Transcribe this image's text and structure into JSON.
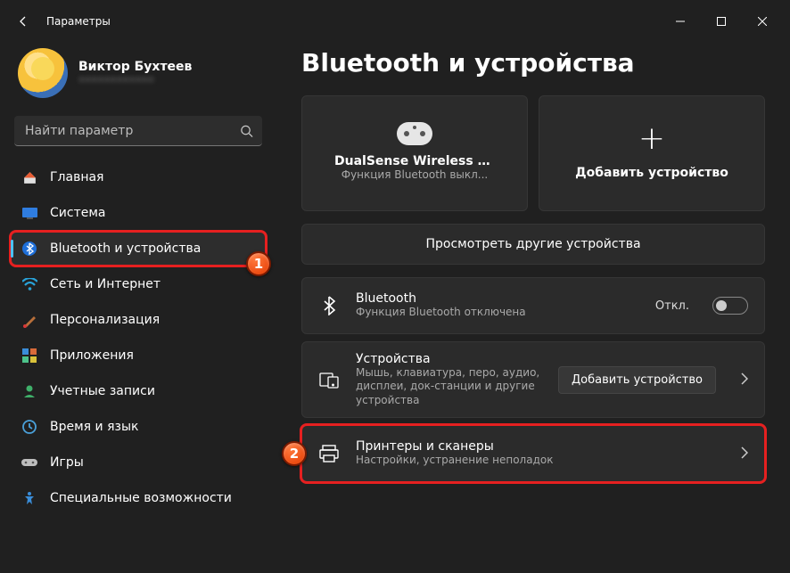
{
  "window": {
    "title": "Параметры"
  },
  "profile": {
    "name": "Виктор Бухтеев",
    "email": "••••••••••••"
  },
  "search": {
    "placeholder": "Найти параметр"
  },
  "sidebar": {
    "items": [
      {
        "label": "Главная"
      },
      {
        "label": "Система"
      },
      {
        "label": "Bluetooth и устройства"
      },
      {
        "label": "Сеть и Интернет"
      },
      {
        "label": "Персонализация"
      },
      {
        "label": "Приложения"
      },
      {
        "label": "Учетные записи"
      },
      {
        "label": "Время и язык"
      },
      {
        "label": "Игры"
      },
      {
        "label": "Специальные возможности"
      }
    ]
  },
  "page": {
    "title": "Bluetooth и устройства",
    "device_card": {
      "title": "DualSense Wireless Cont...",
      "subtitle": "Функция Bluetooth выкл..."
    },
    "add_card": {
      "label": "Добавить устройство"
    },
    "view_more": "Просмотреть другие устройства",
    "bluetooth_row": {
      "title": "Bluetooth",
      "subtitle": "Функция Bluetooth отключена",
      "state_label": "Откл."
    },
    "devices_row": {
      "title": "Устройства",
      "subtitle": "Мышь, клавиатура, перо, аудио, дисплеи, док-станции и другие устройства",
      "action": "Добавить устройство"
    },
    "printers_row": {
      "title": "Принтеры и сканеры",
      "subtitle": "Настройки, устранение неполадок"
    }
  },
  "markers": {
    "one": "1",
    "two": "2"
  }
}
